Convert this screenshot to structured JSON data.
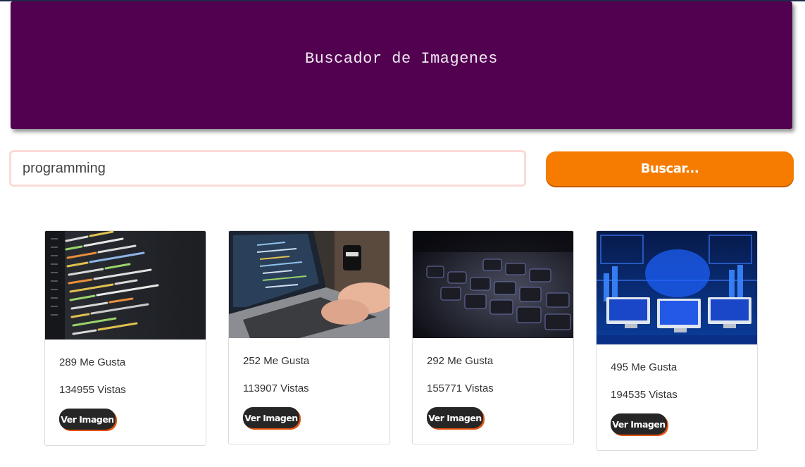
{
  "header": {
    "title": "Buscador de Imagenes"
  },
  "search": {
    "value": "programming",
    "button_label": "Buscar..."
  },
  "results": [
    {
      "likes": "289 Me Gusta",
      "views": "134955 Vistas",
      "button_label": "Ver Imagen"
    },
    {
      "likes": "252 Me Gusta",
      "views": "113907 Vistas",
      "button_label": "Ver Imagen"
    },
    {
      "likes": "292 Me Gusta",
      "views": "155771 Vistas",
      "button_label": "Ver Imagen"
    },
    {
      "likes": "495 Me Gusta",
      "views": "194535 Vistas",
      "button_label": "Ver Imagen"
    }
  ],
  "colors": {
    "banner": "#520050",
    "button": "#f57c00",
    "card_button": "#262626",
    "card_button_shadow": "#e2530e"
  }
}
